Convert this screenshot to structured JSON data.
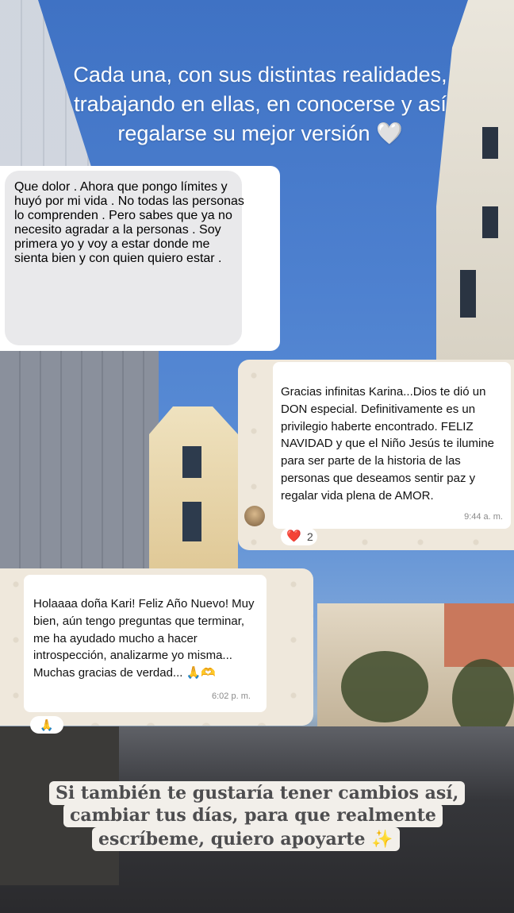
{
  "caption_top": "Cada una, con sus distintas realidades, trabajando en ellas, en conocerse y así regalarse su mejor versión 🤍",
  "card1": {
    "text": "Que dolor . Ahora que pongo límites y huyó por mi vida . No todas las personas lo comprenden . Pero sabes que ya no necesito agradar a la personas . Soy primera yo y voy a estar donde me sienta bien y con quien quiero estar ."
  },
  "card2": {
    "text": "Gracias infinitas Karina...Dios te dió un DON especial. Definitivamente es un privilegio haberte encontrado. FELIZ NAVIDAD y que el Niño Jesús te ilumine para ser parte de la historia de las personas que deseamos sentir paz y regalar vida plena de AMOR.",
    "time": "9:44 a. m.",
    "reaction_emoji": "❤️",
    "reaction_count": "2"
  },
  "card3": {
    "text": "Holaaaa doña Kari! Feliz Año Nuevo! Muy bien, aún tengo preguntas que terminar, me ha ayudado mucho a hacer introspección, analizarme yo misma... Muchas gracias de verdad... 🙏🫶",
    "time": "6:02 p. m.",
    "reaction_emoji": "🙏"
  },
  "caption_bottom": {
    "line1": "Si también te gustaría tener cambios así,",
    "line2": "cambiar tus días, para que realmente",
    "line3": "escríbeme, quiero apoyarte ✨"
  }
}
